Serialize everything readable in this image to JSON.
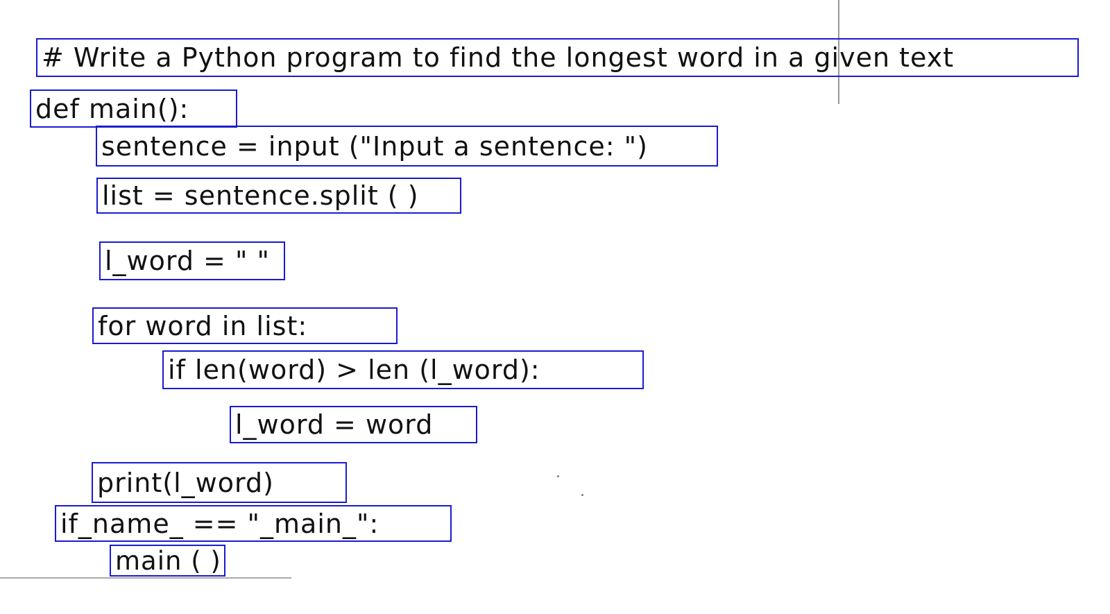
{
  "document": {
    "lines": [
      "# Write a Python program to find the longest word in a given text",
      "def main():",
      "sentence = input (\"Input a sentence: \")",
      "list = sentence.split ( )",
      "l_word = \" \"",
      "for word in list:",
      "if len(word) > len (l_word):",
      "l_word = word",
      "print(l_word)",
      "if_name_ == \"_main_\":",
      "main ( )"
    ]
  },
  "colors": {
    "box_outline": "#1a1ad0",
    "ink": "#111111"
  }
}
